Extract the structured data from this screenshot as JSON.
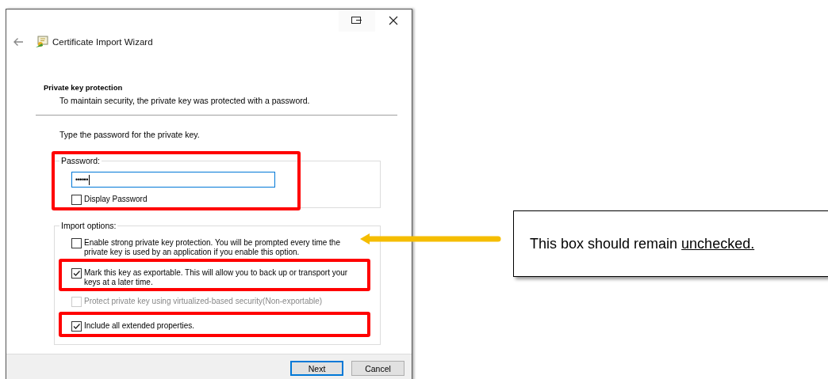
{
  "window": {
    "title": "Certificate Import Wizard"
  },
  "page": {
    "heading": "Private key protection",
    "subheading": "To maintain security, the private key was protected with a password."
  },
  "instruction": "Type the password for the private key.",
  "password_group": {
    "highlighted": true,
    "legend": "Password:",
    "value": "••••••",
    "display_password": {
      "label": "Display Password",
      "checked": false
    }
  },
  "import_options": {
    "legend": "Import options:",
    "options": [
      {
        "label": "Enable strong private key protection. You will be prompted every time the private key is used by an application if you enable this option.",
        "checked": false,
        "disabled": false,
        "highlighted": false
      },
      {
        "label": "Mark this key as exportable. This will allow you to back up or transport your keys at a later time.",
        "checked": true,
        "disabled": false,
        "highlighted": true
      },
      {
        "label": "Protect private key using virtualized-based security(Non-exportable)",
        "checked": false,
        "disabled": true,
        "highlighted": false
      },
      {
        "label": "Include all extended properties.",
        "checked": true,
        "disabled": false,
        "highlighted": true
      }
    ]
  },
  "buttons": [
    {
      "label": "Next",
      "default": true
    },
    {
      "label": "Cancel",
      "default": false
    }
  ],
  "callout": {
    "text": "This box should remain ",
    "underlined": "unchecked."
  }
}
